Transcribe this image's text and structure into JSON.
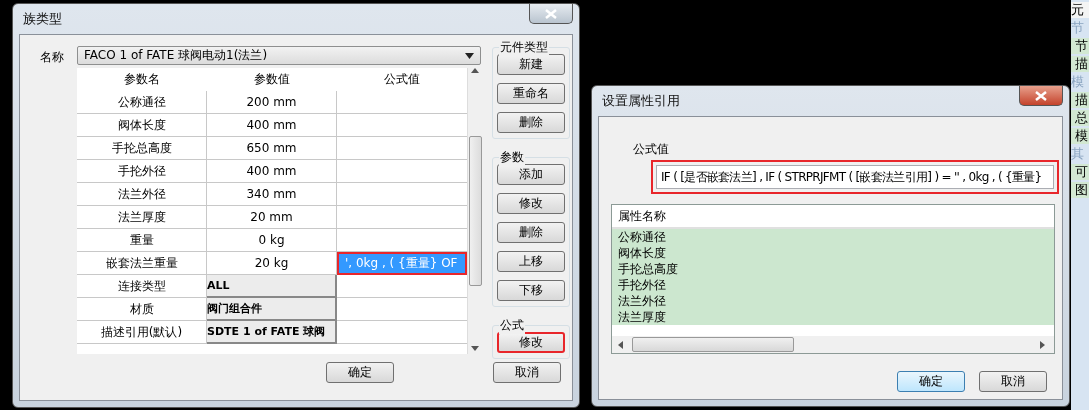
{
  "side_panel": {
    "items": [
      {
        "text": "元",
        "kind": "header"
      },
      {
        "text": "节",
        "kind": "group"
      },
      {
        "text": "节",
        "kind": "item"
      },
      {
        "text": "描",
        "kind": "item"
      },
      {
        "text": "模",
        "kind": "group"
      },
      {
        "text": "描",
        "kind": "item"
      },
      {
        "text": "总",
        "kind": "item"
      },
      {
        "text": "模",
        "kind": "item"
      },
      {
        "text": "其",
        "kind": "group"
      },
      {
        "text": "可",
        "kind": "item"
      },
      {
        "text": "图",
        "kind": "item"
      }
    ]
  },
  "family_dialog": {
    "title": "族类型",
    "name_label": "名称",
    "name_value": "FACO 1 of FATE 球阀电动1(法兰)",
    "columns": [
      "参数名",
      "参数值",
      "公式值"
    ],
    "rows": [
      {
        "name": "公称通径",
        "value": "200 mm",
        "formula": "",
        "kind": "text",
        "selected": false,
        "highlighted": false
      },
      {
        "name": "阀体长度",
        "value": "400 mm",
        "formula": "",
        "kind": "text",
        "selected": false,
        "highlighted": false
      },
      {
        "name": "手抡总高度",
        "value": "650 mm",
        "formula": "",
        "kind": "text",
        "selected": false,
        "highlighted": false
      },
      {
        "name": "手抡外径",
        "value": "400 mm",
        "formula": "",
        "kind": "text",
        "selected": false,
        "highlighted": false
      },
      {
        "name": "法兰外径",
        "value": "340 mm",
        "formula": "",
        "kind": "text",
        "selected": false,
        "highlighted": false
      },
      {
        "name": "法兰厚度",
        "value": "20 mm",
        "formula": "",
        "kind": "text",
        "selected": false,
        "highlighted": false
      },
      {
        "name": "重量",
        "value": "0 kg",
        "formula": "",
        "kind": "text",
        "selected": false,
        "highlighted": false
      },
      {
        "name": "嵌套法兰重量",
        "value": "20 kg",
        "formula": "', 0kg , ( {重量} OF",
        "kind": "text",
        "selected": true,
        "highlighted": true
      },
      {
        "name": "连接类型",
        "value": "ALL",
        "formula": "",
        "kind": "choice",
        "selected": false,
        "highlighted": false
      },
      {
        "name": "材质",
        "value": "阀门组合件",
        "formula": "",
        "kind": "choice",
        "selected": false,
        "highlighted": false
      },
      {
        "name": "描述引用(默认)",
        "value": "SDTE 1 of FATE 球阀",
        "formula": "",
        "kind": "choice",
        "selected": false,
        "highlighted": false
      }
    ],
    "groups": [
      {
        "title": "元件类型",
        "buttons": [
          {
            "label": "新建",
            "highlighted": false
          },
          {
            "label": "重命名",
            "highlighted": false
          },
          {
            "label": "删除",
            "highlighted": false
          }
        ]
      },
      {
        "title": "参数",
        "buttons": [
          {
            "label": "添加",
            "highlighted": false
          },
          {
            "label": "修改",
            "highlighted": false
          },
          {
            "label": "删除",
            "highlighted": false
          },
          {
            "label": "上移",
            "highlighted": false
          },
          {
            "label": "下移",
            "highlighted": false
          }
        ]
      },
      {
        "title": "公式",
        "buttons": [
          {
            "label": "修改",
            "highlighted": true
          }
        ]
      }
    ],
    "ok": "确定",
    "cancel": "取消"
  },
  "reference_dialog": {
    "title": "设置属性引用",
    "formula_label": "公式值",
    "formula_value": "IF ( [是否嵌套法兰] , IF ( STRPRJFMT ( [嵌套法兰引用] ) = '' , 0kg , ( {重量}",
    "formula_highlighted": true,
    "list_header": "属性名称",
    "list_items": [
      "公称通径",
      "阀体长度",
      "手抡总高度",
      "手抡外径",
      "法兰外径",
      "法兰厚度"
    ],
    "ok": "确定",
    "cancel": "取消"
  }
}
